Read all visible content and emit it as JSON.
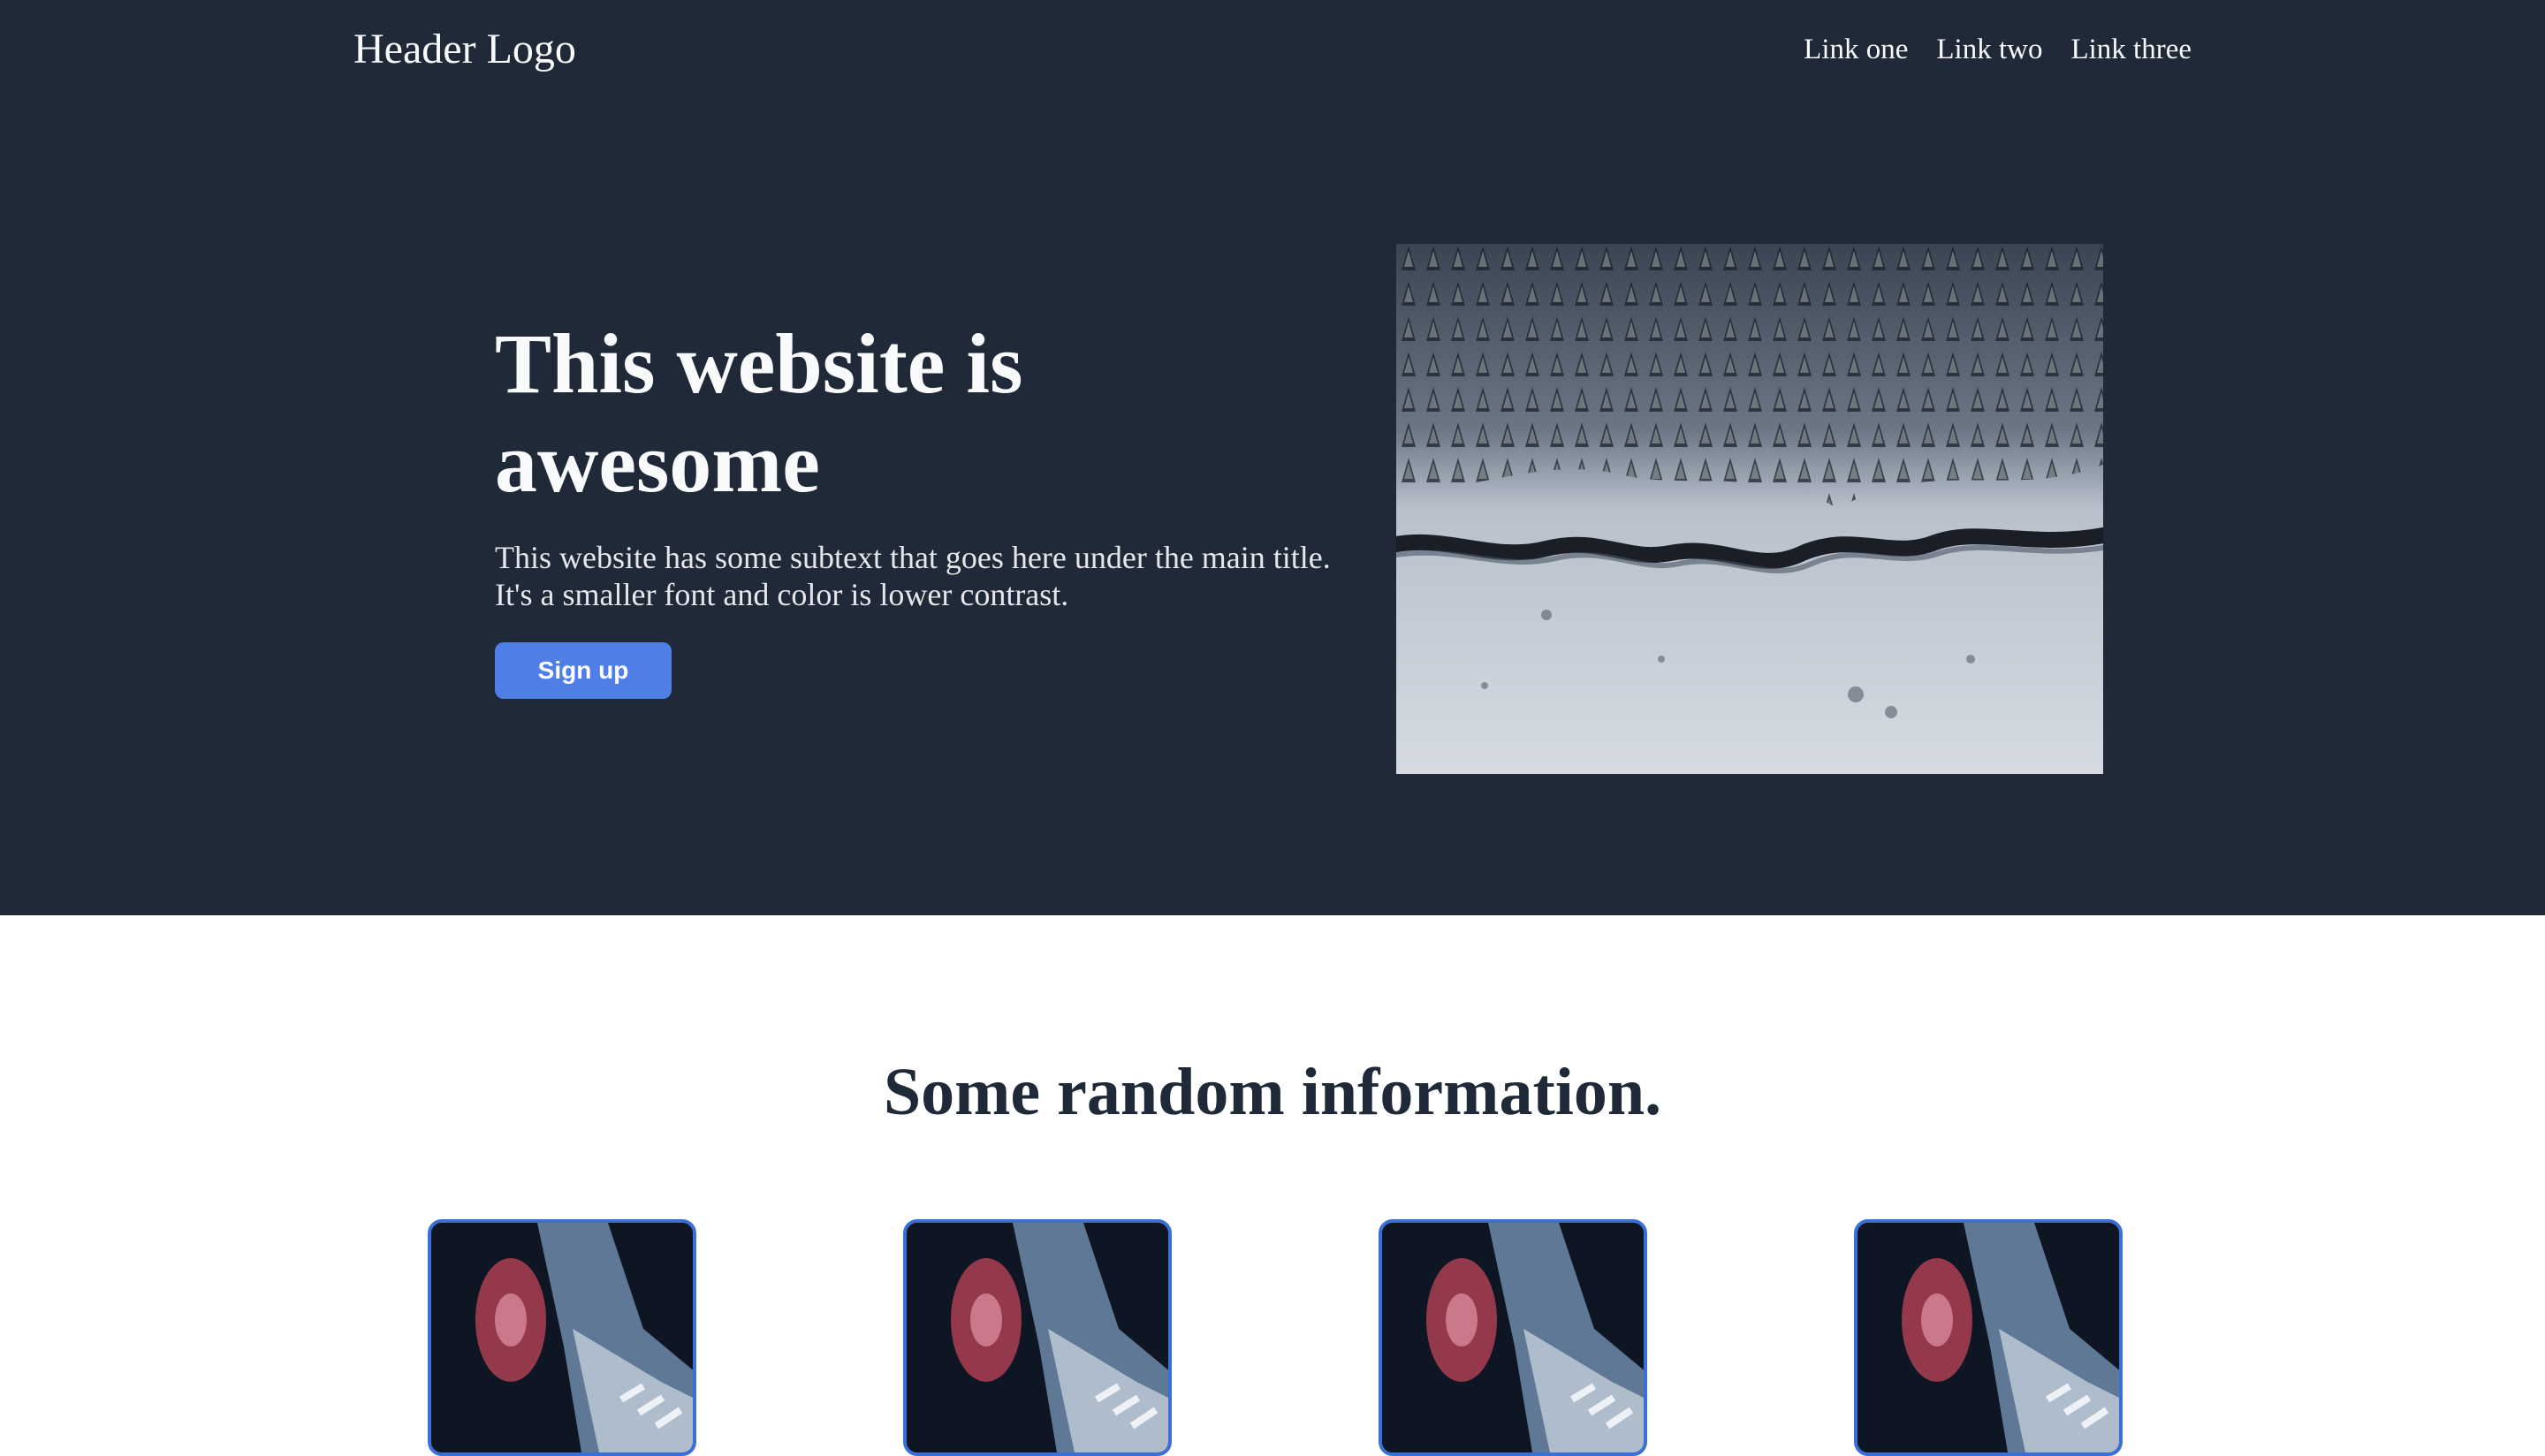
{
  "header": {
    "logo": "Header Logo",
    "links": [
      "Link one",
      "Link two",
      "Link three"
    ]
  },
  "hero": {
    "title": "This website is awesome",
    "subtext": "This website has some subtext that goes here under the main title. It's a smaller font and color is lower contrast.",
    "button_label": "Sign up",
    "image_description_icon": "snowy-forest-river-aerial-photo"
  },
  "info": {
    "title": "Some random information.",
    "card_image_icon": "sneaker-photo"
  },
  "colors": {
    "header_bg": "#1f2937",
    "accent": "#4f7fe6",
    "card_border": "#3b6fd8"
  }
}
